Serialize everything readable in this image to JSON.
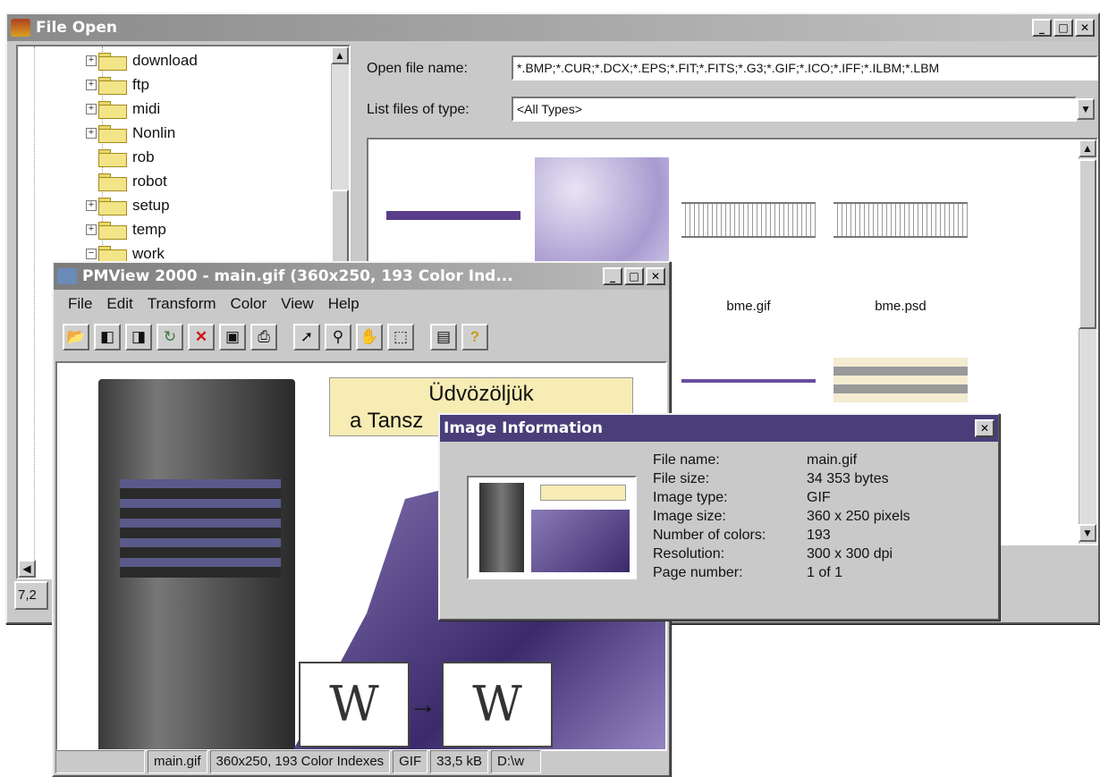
{
  "file_open": {
    "title": "File Open",
    "tree_items": [
      {
        "label": "download",
        "expander": "+"
      },
      {
        "label": "ftp",
        "expander": "+"
      },
      {
        "label": "midi",
        "expander": "+"
      },
      {
        "label": "Nonlin",
        "expander": "+"
      },
      {
        "label": "rob",
        "expander": ""
      },
      {
        "label": "robot",
        "expander": ""
      },
      {
        "label": "setup",
        "expander": "+"
      },
      {
        "label": "temp",
        "expander": "+"
      },
      {
        "label": "work",
        "expander": "−"
      }
    ],
    "status_left": "7,2",
    "open_file_label": "Open file name:",
    "open_file_value": "*.BMP;*.CUR;*.DCX;*.EPS;*.FIT;*.FITS;*.G3;*.GIF;*.ICO;*.IFF;*.ILBM;*.LBM",
    "list_type_label": "List files of type:",
    "list_type_value": "<All Types>",
    "thumbnails": [
      {
        "name": ""
      },
      {
        "name": ""
      },
      {
        "name": "bme.gif"
      },
      {
        "name": "bme.psd"
      }
    ]
  },
  "pmview": {
    "title": "PMView 2000 - main.gif (360x250, 193 Color Ind...",
    "menu": [
      "File",
      "Edit",
      "Transform",
      "Color",
      "View",
      "Help"
    ],
    "image_text_line1": "Üdvözöljük",
    "image_text_line2": "a Tansz",
    "diagram_left": "W",
    "diagram_right": "W",
    "status": [
      "",
      "main.gif",
      "360x250, 193 Color Indexes",
      "GIF",
      "33,5 kB",
      "D:\\w"
    ]
  },
  "image_info": {
    "title": "Image Information",
    "rows": [
      {
        "label": "File name:",
        "value": "main.gif"
      },
      {
        "label": "File size:",
        "value": "34 353 bytes"
      },
      {
        "label": "Image type:",
        "value": "GIF"
      },
      {
        "label": "Image size:",
        "value": "360 x 250 pixels"
      },
      {
        "label": "Number of colors:",
        "value": "193"
      },
      {
        "label": "Resolution:",
        "value": "300 x 300 dpi"
      },
      {
        "label": "Page number:",
        "value": "1 of 1"
      }
    ]
  }
}
